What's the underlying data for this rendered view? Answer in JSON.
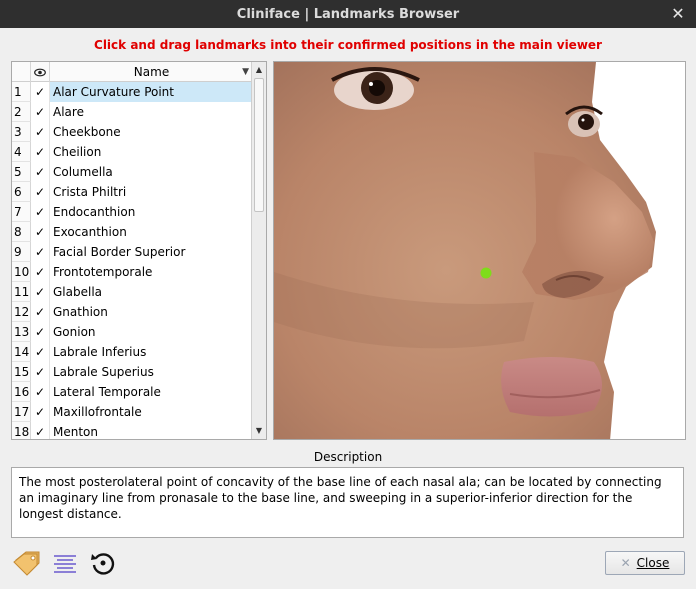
{
  "window": {
    "title": "Cliniface | Landmarks Browser",
    "close_icon": "close-icon"
  },
  "instruction": "Click and drag landmarks into their confirmed positions in the main viewer",
  "table": {
    "header_name": "Name",
    "visibility_icon": "eye-icon",
    "check_glyph": "✓",
    "rows": [
      {
        "num": "1",
        "name": "Alar Curvature Point",
        "checked": true,
        "selected": true
      },
      {
        "num": "2",
        "name": "Alare",
        "checked": true
      },
      {
        "num": "3",
        "name": "Cheekbone",
        "checked": true
      },
      {
        "num": "4",
        "name": "Cheilion",
        "checked": true
      },
      {
        "num": "5",
        "name": "Columella",
        "checked": true
      },
      {
        "num": "6",
        "name": "Crista Philtri",
        "checked": true
      },
      {
        "num": "7",
        "name": "Endocanthion",
        "checked": true
      },
      {
        "num": "8",
        "name": "Exocanthion",
        "checked": true
      },
      {
        "num": "9",
        "name": "Facial Border Superior",
        "checked": true
      },
      {
        "num": "10",
        "name": "Frontotemporale",
        "checked": true
      },
      {
        "num": "11",
        "name": "Glabella",
        "checked": true
      },
      {
        "num": "12",
        "name": "Gnathion",
        "checked": true
      },
      {
        "num": "13",
        "name": "Gonion",
        "checked": true
      },
      {
        "num": "14",
        "name": "Labrale Inferius",
        "checked": true
      },
      {
        "num": "15",
        "name": "Labrale Superius",
        "checked": true
      },
      {
        "num": "16",
        "name": "Lateral Temporale",
        "checked": true
      },
      {
        "num": "17",
        "name": "Maxillofrontale",
        "checked": true
      },
      {
        "num": "18",
        "name": "Menton",
        "checked": true
      }
    ]
  },
  "description": {
    "title": "Description",
    "text": "The most posterolateral point of concavity of the base line of each nasal ala; can be located by connecting an imaginary line from pronasale to the base line, and sweeping in a superior-inferior direction for the longest distance."
  },
  "toolbar": {
    "tag_icon": "tag-icon",
    "align_icon": "align-center-icon",
    "reset_icon": "reset-icon"
  },
  "close_button": {
    "label": "Close"
  },
  "colors": {
    "instruction": "#e00000",
    "landmark": "#7fdc1a",
    "selected_row": "#cde8f8"
  }
}
